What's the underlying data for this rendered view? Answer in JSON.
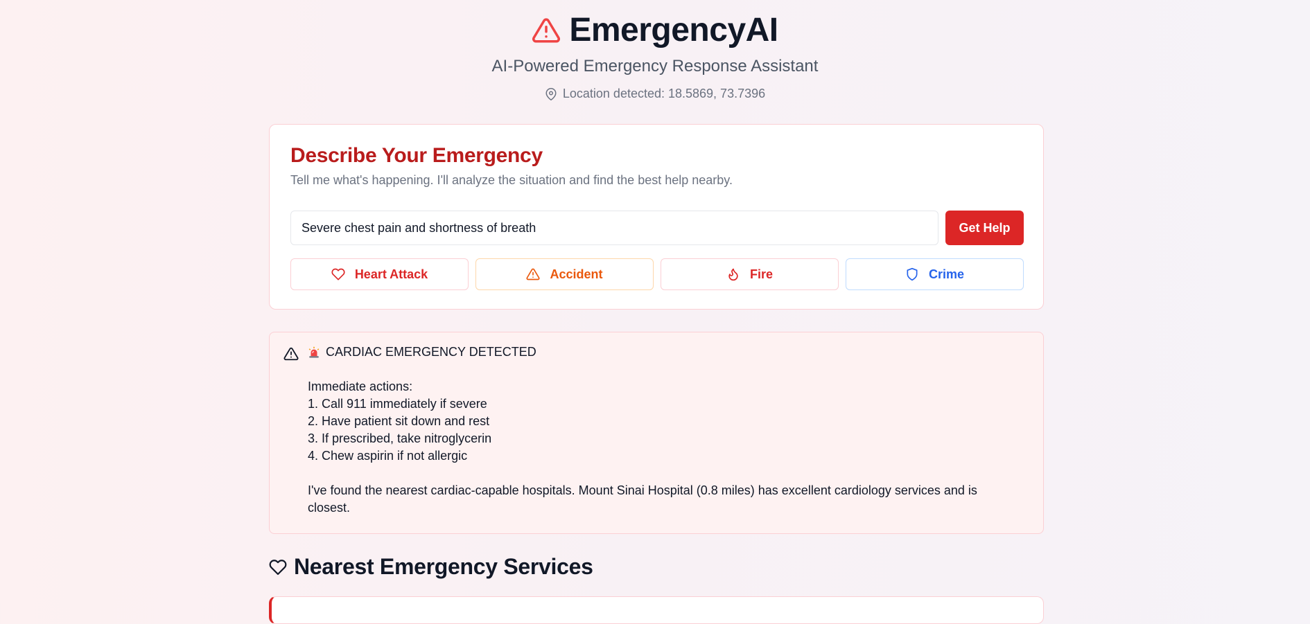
{
  "header": {
    "title": "EmergencyAI",
    "subtitle": "AI-Powered Emergency Response Assistant",
    "location_text": "Location detected: 18.5869, 73.7396",
    "icons": {
      "brand": "alert-triangle-icon",
      "location": "map-pin-icon"
    }
  },
  "emergency_form": {
    "title": "Describe Your Emergency",
    "description": "Tell me what's happening. I'll analyze the situation and find the best help nearby.",
    "input_value": "Severe chest pain and shortness of breath",
    "submit_label": "Get Help",
    "quick_buttons": [
      {
        "label": "Heart Attack",
        "icon": "heart-icon",
        "color": "#dc2626"
      },
      {
        "label": "Accident",
        "icon": "alert-triangle-icon",
        "color": "#ea580c"
      },
      {
        "label": "Fire",
        "icon": "flame-icon",
        "color": "#dc2626"
      },
      {
        "label": "Crime",
        "icon": "shield-icon",
        "color": "#2563eb"
      }
    ]
  },
  "alert": {
    "heading": "CARDIAC EMERGENCY DETECTED",
    "actions_title": "Immediate actions:",
    "actions": [
      "1. Call 911 immediately if severe",
      "2. Have patient sit down and rest",
      "3. If prescribed, take nitroglycerin",
      "4. Chew aspirin if not allergic"
    ],
    "summary": "I've found the nearest cardiac-capable hospitals. Mount Sinai Hospital (0.8 miles) has excellent cardiology services and is closest."
  },
  "services": {
    "heading": "Nearest Emergency Services"
  },
  "colors": {
    "accent_red": "#dc2626",
    "title_red": "#b91c1c",
    "orange": "#ea580c",
    "blue": "#2563eb"
  }
}
